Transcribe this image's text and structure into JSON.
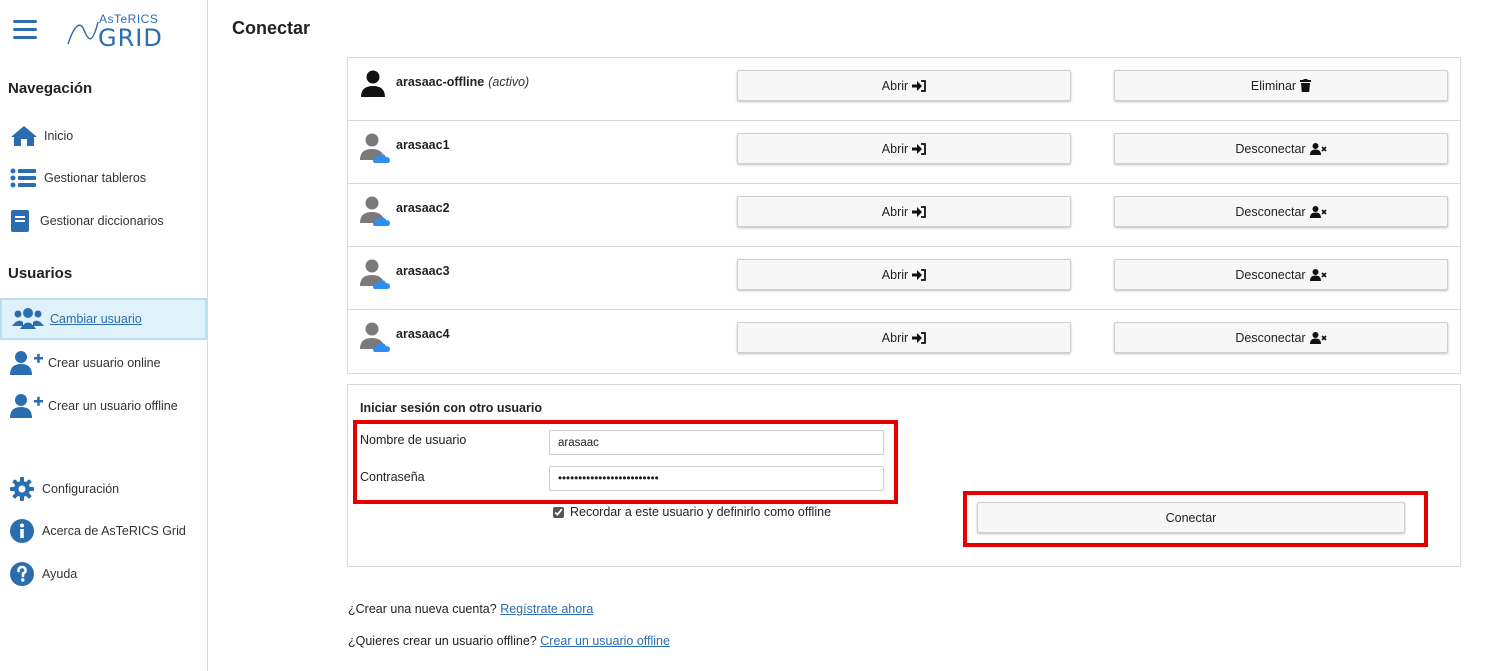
{
  "sidebar": {
    "logo_top": "AsTeRICS",
    "logo_bottom": "GRID",
    "section_navigation": "Navegación",
    "nav_items": [
      {
        "label": "Inicio",
        "icon": "home-icon"
      },
      {
        "label": "Gestionar tableros",
        "icon": "list-icon"
      },
      {
        "label": "Gestionar diccionarios",
        "icon": "book-icon"
      }
    ],
    "section_users": "Usuarios",
    "user_items": [
      {
        "label": "Cambiar usuario",
        "icon": "users-icon",
        "active": true
      },
      {
        "label": "Crear usuario online",
        "icon": "user-plus-icon"
      },
      {
        "label": "Crear un usuario offline",
        "icon": "user-plus-icon"
      }
    ],
    "bottom_items": [
      {
        "label": "Configuración",
        "icon": "gear-icon"
      },
      {
        "label": "Acerca de AsTeRICS Grid",
        "icon": "info-icon"
      },
      {
        "label": "Ayuda",
        "icon": "question-icon"
      }
    ]
  },
  "main": {
    "title": "Conectar",
    "users": [
      {
        "name": "arasaac-offline",
        "status": "(activo)",
        "open_label": "Abrir",
        "action_label": "Eliminar",
        "action_icon": "trash-icon"
      },
      {
        "name": "arasaac1",
        "status": "",
        "open_label": "Abrir",
        "action_label": "Desconectar",
        "action_icon": "user-times-icon"
      },
      {
        "name": "arasaac2",
        "status": "",
        "open_label": "Abrir",
        "action_label": "Desconectar",
        "action_icon": "user-times-icon"
      },
      {
        "name": "arasaac3",
        "status": "",
        "open_label": "Abrir",
        "action_label": "Desconectar",
        "action_icon": "user-times-icon"
      },
      {
        "name": "arasaac4",
        "status": "",
        "open_label": "Abrir",
        "action_label": "Desconectar",
        "action_icon": "user-times-icon"
      }
    ],
    "login": {
      "title": "Iniciar sesión con otro usuario",
      "username_label": "Nombre de usuario",
      "username_value": "arasaac",
      "password_label": "Contraseña",
      "password_value": "•••••••••••••••••••••••••",
      "remember_label": "Recordar a este usuario y definirlo como offline",
      "remember_checked": true,
      "connect_label": "Conectar"
    },
    "footer": {
      "new_account_text": "¿Crear una nueva cuenta?",
      "new_account_link": "Regístrate ahora",
      "offline_text": "¿Quieres crear un usuario offline?",
      "offline_link": "Crear un usuario offline"
    }
  },
  "colors": {
    "accent": "#2a6db0",
    "highlight": "#e60000",
    "active_bg": "#dff1fb",
    "cloud": "#2f8ff0"
  }
}
